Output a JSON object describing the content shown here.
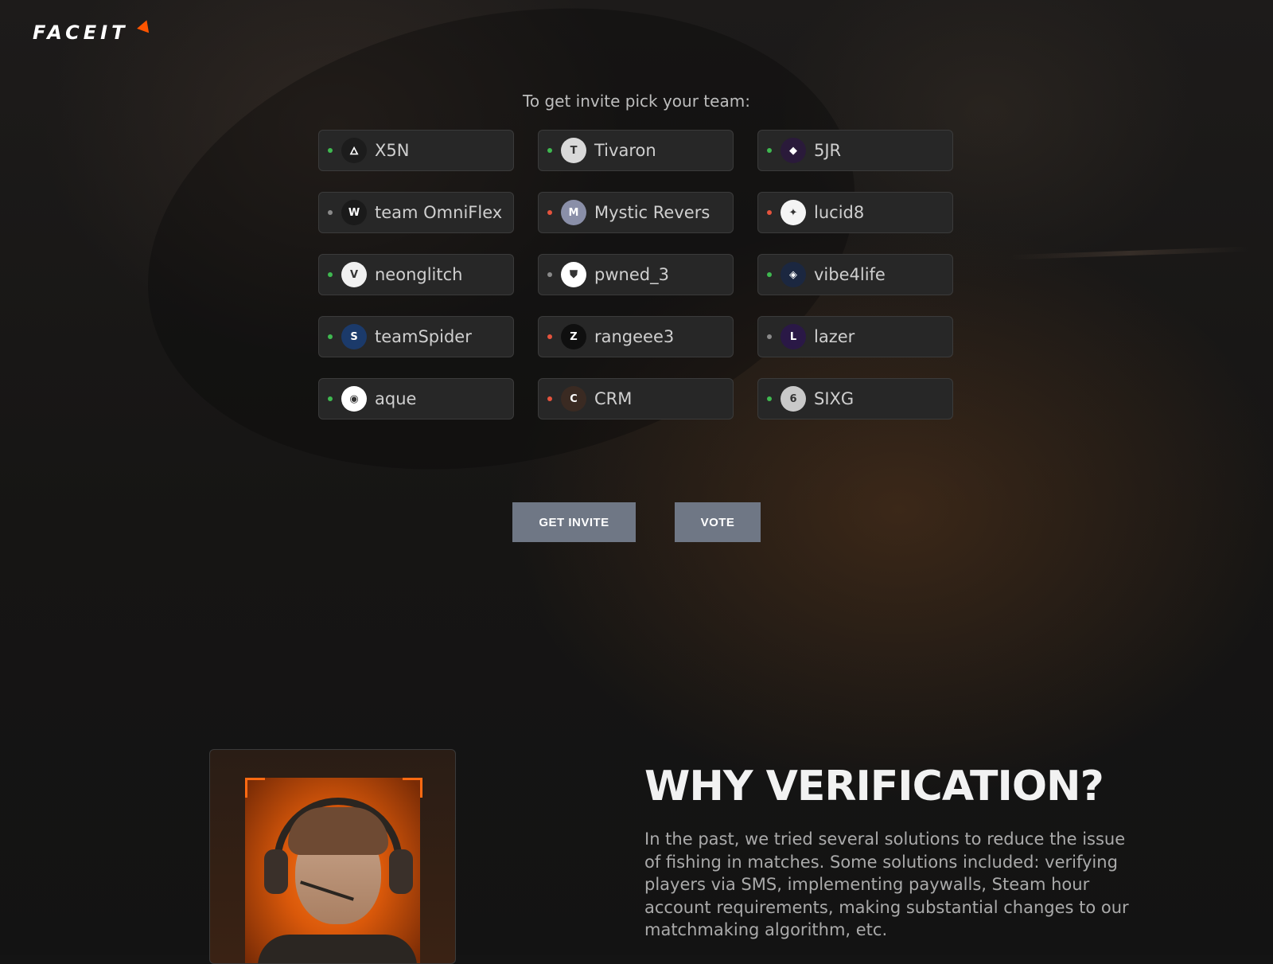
{
  "brand": {
    "logo": "FACEIT",
    "accent_color": "#ff5500"
  },
  "pick_title": "To get invite pick your team:",
  "teams": [
    {
      "name": "X5N",
      "status": "green",
      "icon": "red-bird-emblem-icon",
      "avatar_bg": "#1c1c1c",
      "avatar_glyph": "🜂"
    },
    {
      "name": "Tivaron",
      "status": "green",
      "icon": "teal-t-logo-icon",
      "avatar_bg": "#d9d9d9",
      "avatar_glyph": "T"
    },
    {
      "name": "5JR",
      "status": "green",
      "icon": "purple-dragon-icon",
      "avatar_bg": "#2a1a3a",
      "avatar_glyph": "◆"
    },
    {
      "name": "team OmniFlex",
      "status": "gray",
      "icon": "wings-logo-icon",
      "avatar_bg": "#1a1a1a",
      "avatar_glyph": "W"
    },
    {
      "name": "Mystic Revers",
      "status": "red",
      "icon": "mystic-figure-icon",
      "avatar_bg": "#8a8fa8",
      "avatar_glyph": "M"
    },
    {
      "name": "lucid8",
      "status": "red",
      "icon": "white-crab-icon",
      "avatar_bg": "#f4f4f4",
      "avatar_glyph": "✦"
    },
    {
      "name": "neonglitch",
      "status": "green",
      "icon": "red-v-shield-icon",
      "avatar_bg": "#f0f0f0",
      "avatar_glyph": "V"
    },
    {
      "name": "pwned_3",
      "status": "gray",
      "icon": "golden-helmet-icon",
      "avatar_bg": "#ffffff",
      "avatar_glyph": "⛊"
    },
    {
      "name": "vibe4life",
      "status": "green",
      "icon": "blue-crest-icon",
      "avatar_bg": "#1b2740",
      "avatar_glyph": "◈"
    },
    {
      "name": "teamSpider",
      "status": "green",
      "icon": "spider-figure-icon",
      "avatar_bg": "#1b3a6a",
      "avatar_glyph": "S"
    },
    {
      "name": "rangeee3",
      "status": "red",
      "icon": "z-diamond-icon",
      "avatar_bg": "#0f0f0f",
      "avatar_glyph": "Z"
    },
    {
      "name": "lazer",
      "status": "gray",
      "icon": "purple-wolf-icon",
      "avatar_bg": "#2a1846",
      "avatar_glyph": "L"
    },
    {
      "name": "aque",
      "status": "green",
      "icon": "blue-eye-icon",
      "avatar_bg": "#ffffff",
      "avatar_glyph": "◉"
    },
    {
      "name": "CRM",
      "status": "red",
      "icon": "orange-tiger-icon",
      "avatar_bg": "#3a2a22",
      "avatar_glyph": "C"
    },
    {
      "name": "SIXG",
      "status": "green",
      "icon": "white-tiger-icon",
      "avatar_bg": "#c9c9c9",
      "avatar_glyph": "6"
    }
  ],
  "status_colors": {
    "green": "#3fb950",
    "red": "#e5533d",
    "gray": "#8a8a8a"
  },
  "buttons": {
    "get_invite": "GET INVITE",
    "vote": "VOTE",
    "color": "#6f7785"
  },
  "why": {
    "title": "WHY VERIFICATION?",
    "text": "In the past, we tried several solutions to reduce the issue of fishing in matches. Some solutions included: verifying players via SMS, implementing paywalls, Steam hour account requirements, making substantial changes to our matchmaking algorithm, etc."
  }
}
